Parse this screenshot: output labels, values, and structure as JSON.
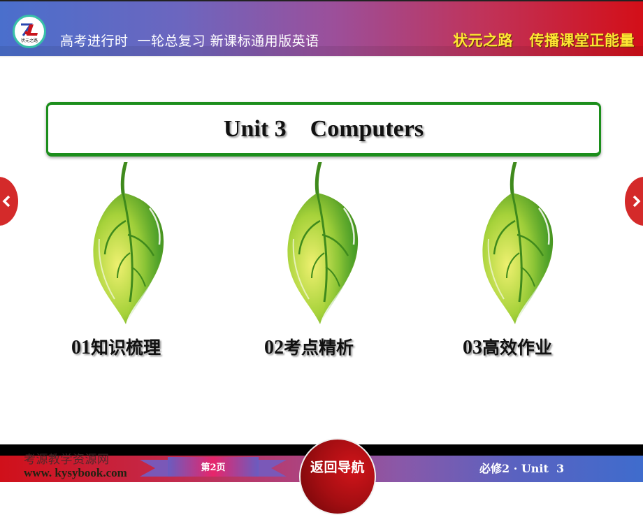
{
  "header": {
    "logo_icon": "zhuangyuan-logo-icon",
    "title": "高考进行时  一轮总复习 新课标通用版英语",
    "slogan": "状元之路   传播课堂正能量"
  },
  "slide": {
    "title": "Unit 3    Computers",
    "sections": [
      {
        "num": "01",
        "label": "知识梳理",
        "icon": "leaf-icon"
      },
      {
        "num": "02",
        "label": "考点精析",
        "icon": "leaf-icon"
      },
      {
        "num": "03",
        "label": "高效作业",
        "icon": "leaf-icon"
      }
    ]
  },
  "nav": {
    "prev_icon": "chevron-left-icon",
    "next_icon": "chevron-right-icon"
  },
  "footer": {
    "watermark_cn": "考源教学资源网",
    "watermark_url": "www. kysybook.com",
    "page_label": "第2页",
    "back_label": "返回导航",
    "unit_label": "必修2 · Unit  3"
  },
  "colors": {
    "header_gradient_start": "#4a6fcc",
    "header_gradient_end": "#d30f18",
    "slogan_text": "#ffe733",
    "title_border": "#1c8e1c",
    "nav_arrow": "#d42a2a",
    "back_button": "#a50e12"
  }
}
